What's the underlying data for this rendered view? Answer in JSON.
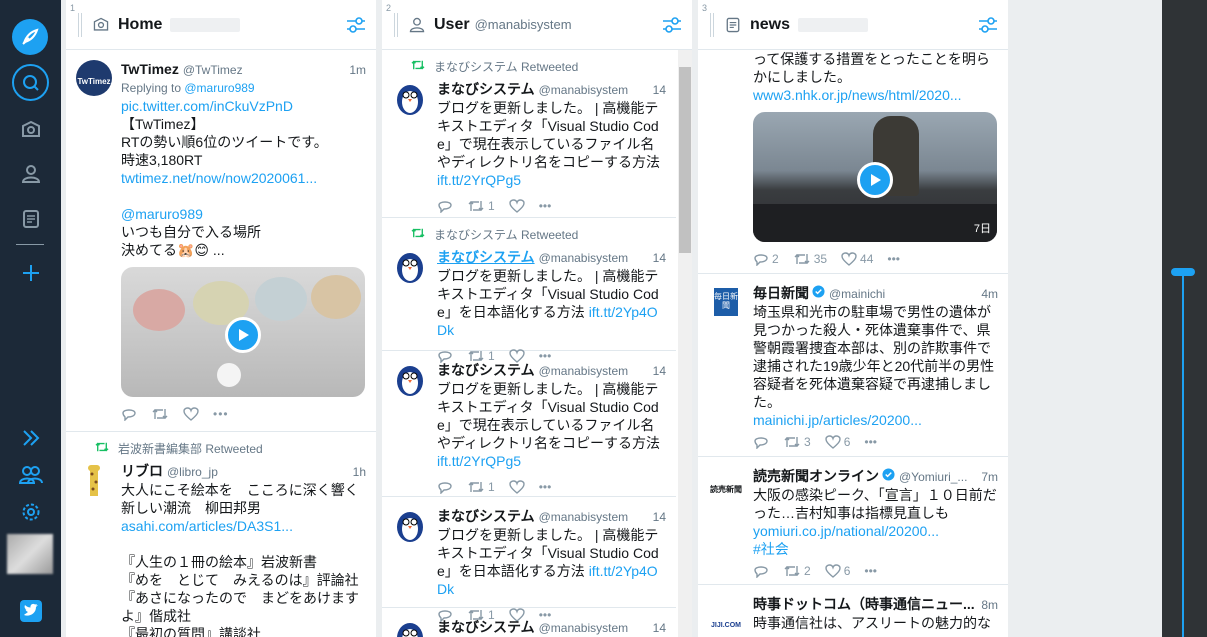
{
  "nav": {
    "compose_icon": "feather-icon",
    "items": [
      "search-icon",
      "home-icon",
      "user-icon",
      "list-icon",
      "add-icon",
      "expand-icon",
      "people-icon",
      "gear-icon",
      "twitter-icon"
    ]
  },
  "columns": [
    {
      "num": "1",
      "title": "Home",
      "subtitle": "",
      "tweets": [
        {
          "name": "TwTimez",
          "handle": "@TwTimez",
          "time": "1m",
          "reply_prefix": "Replying to ",
          "reply_to": "@maruro989",
          "lines": [
            "pic.twitter.com/inCkuVzPnD",
            "【TwTimez】",
            "RTの勢い順6位のツイートです。",
            "時速3,180RT",
            "twtimez.net/now/now2020061...",
            "",
            "@maruro989",
            "いつも自分で入る場所",
            "決めてる🐹😊 ..."
          ]
        },
        {
          "rt_by": "岩波新書編集部 Retweeted",
          "name": "リブロ",
          "handle": "@libro_jp",
          "time": "1h",
          "lines": [
            "大人にこそ絵本を　こころに深く響く新しい潮流　柳田邦男",
            "asahi.com/articles/DA3S1...",
            "",
            "『人生の１冊の絵本』岩波新書",
            "『めを　とじて　みえるのは』評論社",
            "『あさになったので　まどをあけますよ』偕成社",
            "『最初の質問』講談社"
          ]
        }
      ]
    },
    {
      "num": "2",
      "title": "User",
      "subtitle": "@manabisystem",
      "tweets": [
        {
          "rt_by": "まなびシステム Retweeted",
          "name": "まなびシステム",
          "handle": "@manabisystem",
          "time": "14",
          "lines": [
            "ブログを更新しました。 | 高機能テキストエディタ「Visual Studio Code」で現在表示しているファイル名やディレクトリ名をコピーする方法",
            "ift.tt/2YrQPg5"
          ],
          "rt": "1"
        },
        {
          "rt_by": "まなびシステム Retweeted",
          "name": "まなびシステム",
          "handle": "@manabisystem",
          "time": "14",
          "lines": [
            "ブログを更新しました。 | 高機能テキストエディタ「Visual Studio Code」を日本語化する方法 ",
            "ift.tt/2Yp4ODk"
          ],
          "rt": "1"
        },
        {
          "name": "まなびシステム",
          "handle": "@manabisystem",
          "time": "14",
          "lines": [
            "ブログを更新しました。 | 高機能テキストエディタ「Visual Studio Code」で現在表示しているファイル名やディレクトリ名をコピーする方法",
            "ift.tt/2YrQPg5"
          ],
          "rt": "1"
        },
        {
          "name": "まなびシステム",
          "handle": "@manabisystem",
          "time": "14",
          "lines": [
            "ブログを更新しました。 | 高機能テキストエディタ「Visual Studio Code」を日本語化する方法 ",
            "ift.tt/2Yp4ODk"
          ],
          "rt": "1"
        },
        {
          "name": "まなびシステム",
          "handle": "@manabisystem",
          "time": "14",
          "lines": [],
          "rt": ""
        }
      ]
    },
    {
      "num": "3",
      "title": "news",
      "subtitle": "",
      "tweets": [
        {
          "lines": [
            "って保護する措置をとったことを明らかにしました。",
            "www3.nhk.or.jp/news/html/2020..."
          ],
          "video_duration": "7日",
          "replies": "2",
          "rt": "35",
          "likes": "44"
        },
        {
          "name": "毎日新聞",
          "handle": "@mainichi",
          "time": "4m",
          "verified": true,
          "lines": [
            "埼玉県和光市の駐車場で男性の遺体が見つかった殺人・死体遺棄事件で、県警朝霞署捜査本部は、別の詐欺事件で逮捕された19歳少年と20代前半の男性容疑者を死体遺棄容疑で再逮捕しました。",
            "mainichi.jp/articles/20200..."
          ],
          "rt": "3",
          "likes": "6",
          "logo": "毎日新聞"
        },
        {
          "name": "読売新聞オンライン",
          "handle": "@Yomiuri_...",
          "time": "7m",
          "verified": true,
          "lines": [
            "大阪の感染ピーク、「宣言」１０日前だった…吉村知事は指標見直しも",
            "yomiuri.co.jp/national/20200...",
            "#社会"
          ],
          "rt": "2",
          "likes": "6",
          "logo": "読売新聞"
        },
        {
          "name": "時事ドットコム（時事通信ニュー...",
          "handle": "",
          "time": "8m",
          "lines": [
            "時事通信社は、アスリートの魅力的な"
          ],
          "logo": "JIJI.COM"
        }
      ]
    }
  ],
  "colors": {
    "accent": "#1da1f2",
    "nav_bg": "#1c2938",
    "retweet": "#17bf63"
  }
}
